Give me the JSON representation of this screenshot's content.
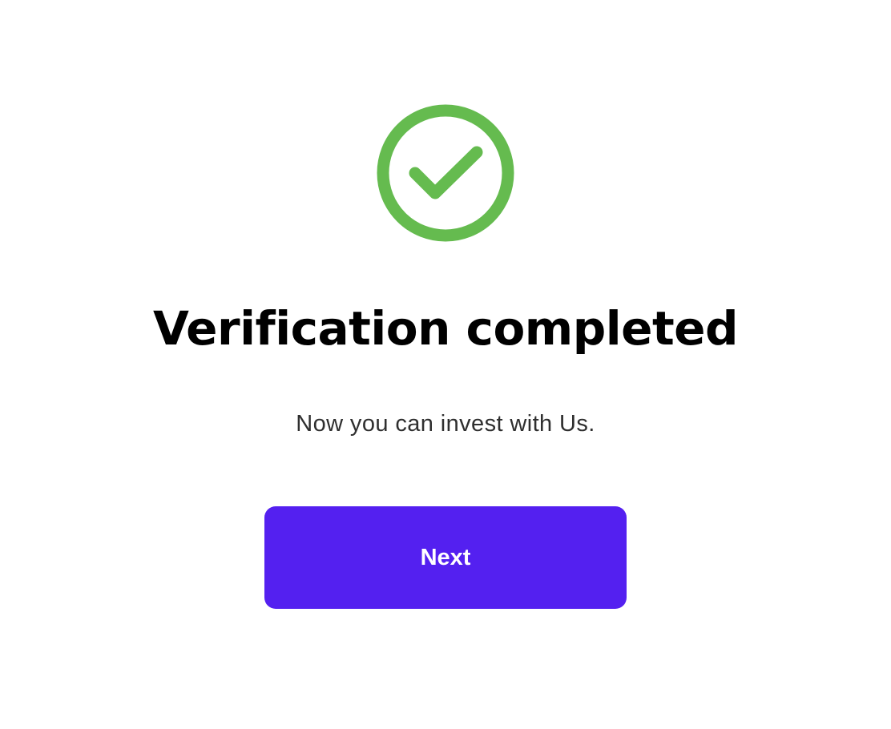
{
  "screen": {
    "icon": "check-circle-icon",
    "icon_color": "#65bb4f",
    "title": "Verification completed",
    "subtitle": "Now you can invest with Us.",
    "button_label": "Next",
    "button_color": "#5420f0"
  }
}
